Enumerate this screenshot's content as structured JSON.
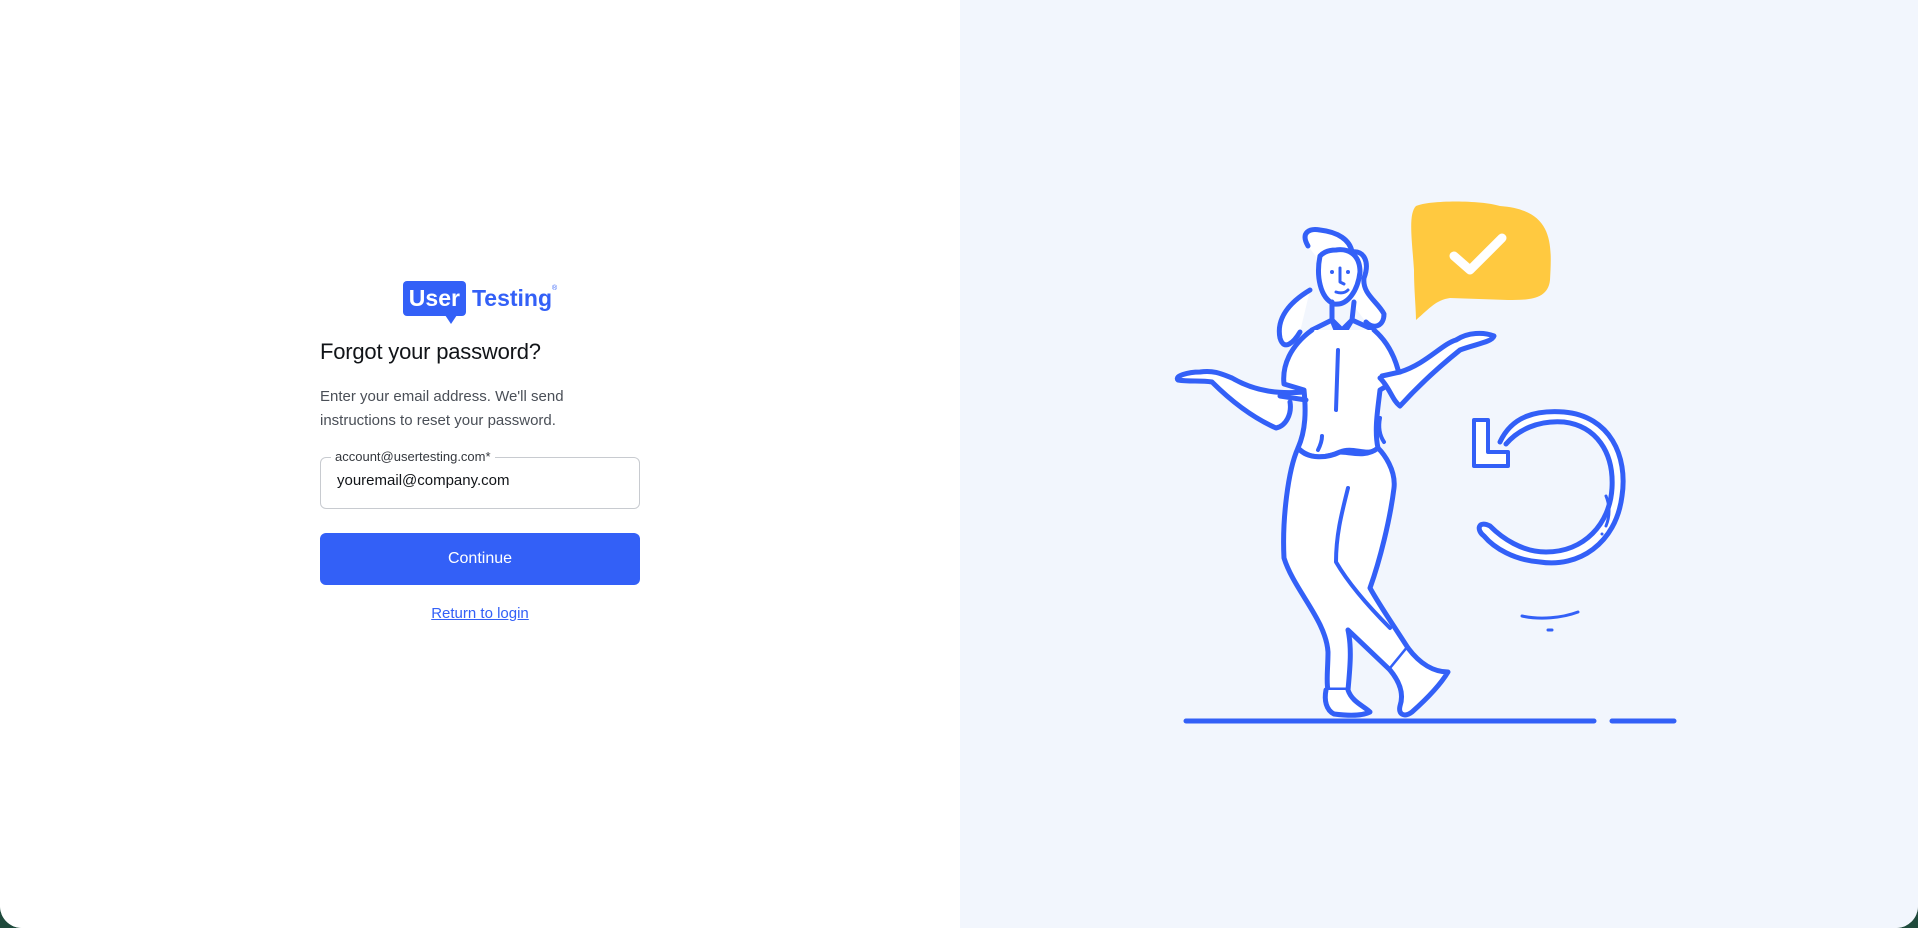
{
  "brand": {
    "logo_user": "User",
    "logo_testing": "Testing",
    "logo_tm": "®",
    "accent_color": "#3360f7"
  },
  "page": {
    "title": "Forgot your password?",
    "description": "Enter your email address. We'll send instructions to reset your password."
  },
  "email_field": {
    "label": "account@usertesting.com*",
    "placeholder": "youremail@company.com",
    "value": ""
  },
  "actions": {
    "continue_label": "Continue",
    "return_label": "Return to login"
  },
  "illustration": {
    "subject": "person-shrugging-with-check-bubble-and-refresh-arrow",
    "stroke_color": "#3360f7",
    "bubble_color": "#ffc940",
    "background_color": "#f2f6fd"
  }
}
